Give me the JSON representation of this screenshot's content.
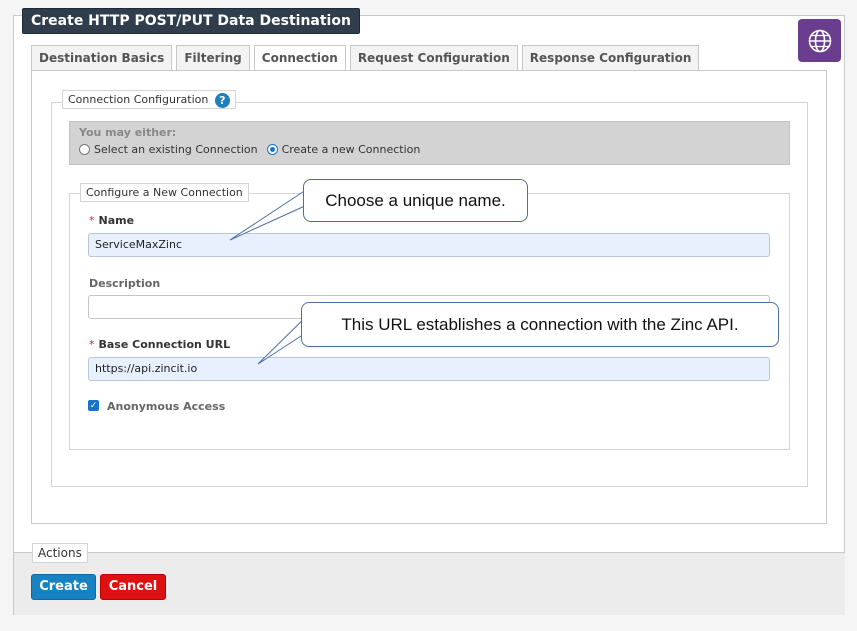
{
  "window": {
    "title": "Create HTTP POST/PUT Data Destination",
    "globe_icon": "globe-icon"
  },
  "tabs": [
    {
      "label": "Destination Basics",
      "active": false
    },
    {
      "label": "Filtering",
      "active": false
    },
    {
      "label": "Connection",
      "active": true
    },
    {
      "label": "Request Configuration",
      "active": false
    },
    {
      "label": "Response Configuration",
      "active": false
    }
  ],
  "connection_config": {
    "legend": "Connection Configuration",
    "help_icon": "?",
    "either_title": "You may either:",
    "option_existing": "Select an existing Connection",
    "option_new": "Create a new Connection",
    "selected_option": "new"
  },
  "new_connection": {
    "legend": "Configure a New Connection",
    "name_label": "Name",
    "name_value": "ServiceMaxZinc",
    "description_label": "Description",
    "description_value": "",
    "base_url_label": "Base Connection URL",
    "base_url_value": "https://api.zincit.io",
    "anonymous_label": "Anonymous Access",
    "anonymous_checked": true
  },
  "callouts": {
    "name": "Choose a unique name.",
    "url": "This URL establishes a connection with the Zinc API."
  },
  "actions": {
    "legend": "Actions",
    "create_label": "Create",
    "cancel_label": "Cancel"
  },
  "colors": {
    "title_bg": "#2f3d4c",
    "globe_bg": "#6a3d8f",
    "create_bg": "#1782c1",
    "cancel_bg": "#dd1111",
    "required": "#dd2222"
  }
}
